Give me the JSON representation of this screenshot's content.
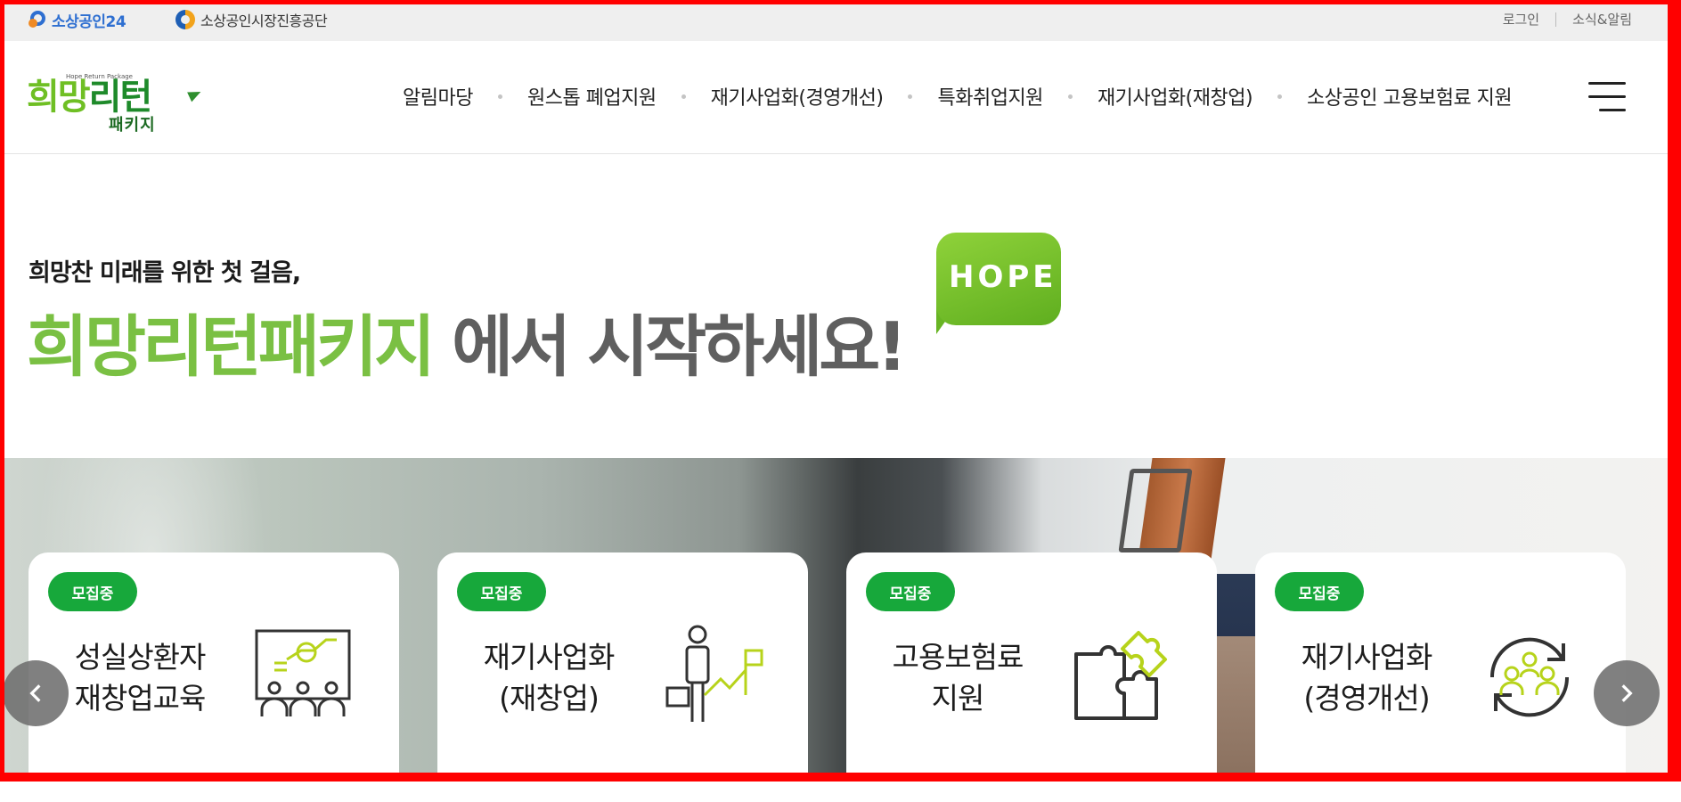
{
  "topbar": {
    "logo1_text": "소상공인24",
    "logo2_text": "소상공인시장진흥공단",
    "login_label": "로그인",
    "news_label": "소식&알림"
  },
  "brand": {
    "small": "Hope Return Package",
    "main_a": "희망",
    "main_b": "리턴",
    "sub": "패키지"
  },
  "nav": {
    "items": [
      "알림마당",
      "원스톱 폐업지원",
      "재기사업화(경영개선)",
      "특화취업지원",
      "재기사업화(재창업)",
      "소상공인 고용보험료 지원"
    ]
  },
  "hero": {
    "subtitle": "희망찬 미래를 위한 첫 걸음,",
    "title_green": "희망리턴패키지",
    "title_gray": " 에서 시작하세요!",
    "hope_text": "HOPE"
  },
  "cards": [
    {
      "badge": "모집중",
      "line1": "성실상환자",
      "line2": "재창업교육",
      "icon": "presentation-icon"
    },
    {
      "badge": "모집중",
      "line1": "재기사업화",
      "line2": "(재창업)",
      "icon": "person-briefcase-flag-icon"
    },
    {
      "badge": "모집중",
      "line1": "고용보험료",
      "line2": "지원",
      "icon": "puzzle-icon"
    },
    {
      "badge": "모집중",
      "line1": "재기사업화",
      "line2": "(경영개선)",
      "icon": "people-cycle-icon"
    }
  ],
  "colors": {
    "accent_green": "#7ac043",
    "badge_green": "#17a83b",
    "icon_lime": "#b7d31b",
    "frame_red": "#ff0000"
  }
}
